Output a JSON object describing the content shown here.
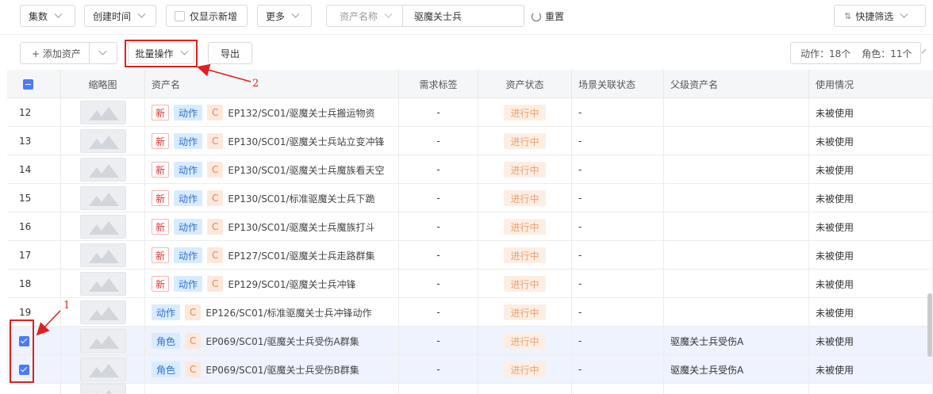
{
  "filters": {
    "episode": "集数",
    "created_time": "创建时间",
    "only_new": "仅显示新增",
    "more": "更多",
    "search_field": "资产名称",
    "search_value": "驱魔关士兵",
    "reset": "重置",
    "quick_filter": "快捷筛选"
  },
  "actions": {
    "add_asset": "+ 添加资产",
    "batch": "批量操作",
    "export": "导出",
    "count_action": "动作：18个",
    "count_role": "角色：11个"
  },
  "columns": [
    "缩略图",
    "资产名",
    "需求标签",
    "资产状态",
    "场景关联状态",
    "父级资产名",
    "使用情况"
  ],
  "rows": [
    {
      "num": "12",
      "is_new": true,
      "new_label": "新",
      "type": "动作",
      "level": "C",
      "name": "EP132/SC01/驱魔关士兵搬运物资",
      "req": "-",
      "status": "进行中",
      "scene": "-",
      "parent": "",
      "usage": "未被使用",
      "selected": false
    },
    {
      "num": "13",
      "is_new": true,
      "new_label": "新",
      "type": "动作",
      "level": "C",
      "name": "EP130/SC01/驱魔关士兵站立变冲锋",
      "req": "-",
      "status": "进行中",
      "scene": "-",
      "parent": "",
      "usage": "未被使用",
      "selected": false
    },
    {
      "num": "14",
      "is_new": true,
      "new_label": "新",
      "type": "动作",
      "level": "C",
      "name": "EP130/SC01/驱魔关士兵魔族看天空",
      "req": "-",
      "status": "进行中",
      "scene": "-",
      "parent": "",
      "usage": "未被使用",
      "selected": false
    },
    {
      "num": "15",
      "is_new": true,
      "new_label": "新",
      "type": "动作",
      "level": "C",
      "name": "EP130/SC01/标准驱魔关士兵下跪",
      "req": "-",
      "status": "进行中",
      "scene": "-",
      "parent": "",
      "usage": "未被使用",
      "selected": false
    },
    {
      "num": "16",
      "is_new": true,
      "new_label": "新",
      "type": "动作",
      "level": "C",
      "name": "EP130/SC01/驱魔关士兵魔族打斗",
      "req": "-",
      "status": "进行中",
      "scene": "-",
      "parent": "",
      "usage": "未被使用",
      "selected": false
    },
    {
      "num": "17",
      "is_new": true,
      "new_label": "新",
      "type": "动作",
      "level": "C",
      "name": "EP127/SC01/驱魔关士兵走路群集",
      "req": "-",
      "status": "进行中",
      "scene": "-",
      "parent": "",
      "usage": "未被使用",
      "selected": false
    },
    {
      "num": "18",
      "is_new": true,
      "new_label": "新",
      "type": "动作",
      "level": "C",
      "name": "EP129/SC01/驱魔关士兵冲锋",
      "req": "-",
      "status": "进行中",
      "scene": "-",
      "parent": "",
      "usage": "未被使用",
      "selected": false
    },
    {
      "num": "19",
      "is_new": false,
      "new_label": "",
      "type": "动作",
      "level": "C",
      "name": "EP126/SC01/标准驱魔关士兵冲锋动作",
      "req": "-",
      "status": "进行中",
      "scene": "-",
      "parent": "",
      "usage": "未被使用",
      "selected": false
    },
    {
      "num": "",
      "is_new": false,
      "new_label": "",
      "type": "角色",
      "level": "C",
      "name": "EP069/SC01/驱魔关士兵受伤A群集",
      "req": "-",
      "status": "进行中",
      "scene": "-",
      "parent": "驱魔关士兵受伤A",
      "usage": "未被使用",
      "selected": true
    },
    {
      "num": "",
      "is_new": false,
      "new_label": "",
      "type": "角色",
      "level": "C",
      "name": "EP069/SC01/驱魔关士兵受伤B群集",
      "req": "-",
      "status": "进行中",
      "scene": "-",
      "parent": "驱魔关士兵受伤A",
      "usage": "未被使用",
      "selected": true
    }
  ],
  "annotations": {
    "label_1": "1",
    "label_2": "2"
  },
  "colors": {
    "accent": "#4a7bf7",
    "annotation": "#e02020",
    "status_bg": "#fdeee4",
    "type_bg": "#d9ebff",
    "level_bg": "#fde8dc"
  }
}
